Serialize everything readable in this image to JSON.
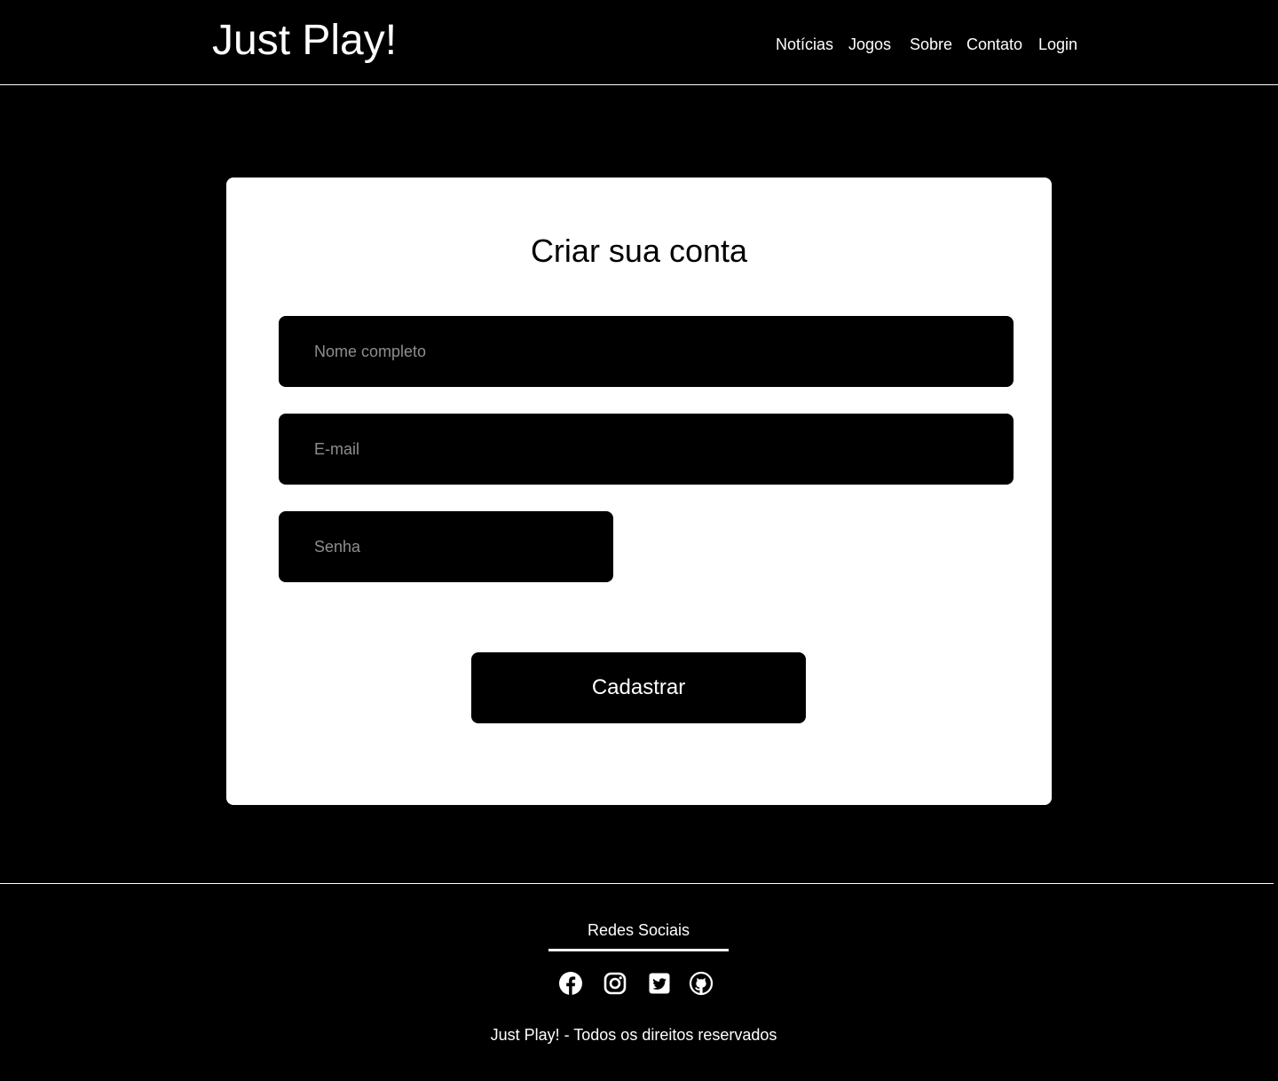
{
  "header": {
    "logo": "Just Play!",
    "nav": [
      "Notícias",
      "Jogos",
      "Sobre",
      "Contato",
      "Login"
    ]
  },
  "form": {
    "title": "Criar sua conta",
    "fields": {
      "name": {
        "placeholder": "Nome completo",
        "value": ""
      },
      "email": {
        "placeholder": "E-mail",
        "value": ""
      },
      "password": {
        "placeholder": "Senha",
        "value": ""
      }
    },
    "submit_label": "Cadastrar"
  },
  "footer": {
    "heading": "Redes Sociais",
    "social_icons": [
      "facebook-icon",
      "instagram-icon",
      "twitter-icon",
      "github-icon"
    ],
    "copyright": "Just Play! - Todos os direitos reservados"
  },
  "colors": {
    "background": "#000000",
    "card": "#ffffff",
    "text": "#ffffff",
    "placeholder": "#8e8e8e"
  }
}
